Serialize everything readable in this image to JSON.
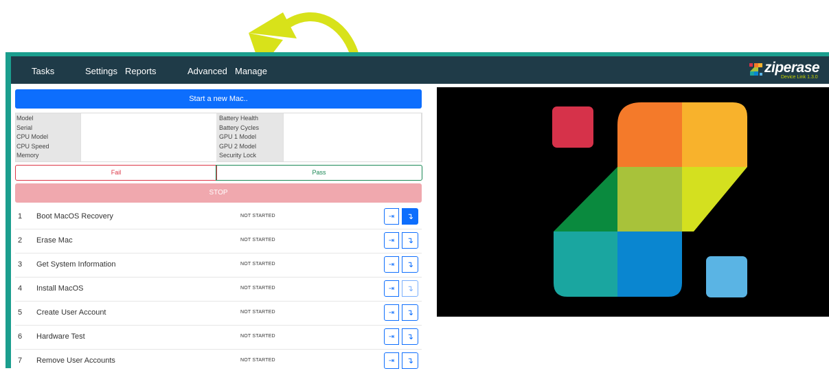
{
  "nav": {
    "tasks": "Tasks",
    "settings": "Settings",
    "reports": "Reports",
    "advanced": "Advanced",
    "manage": "Manage"
  },
  "logo": {
    "name": "ziperase",
    "version": "Device Link 1.3.0"
  },
  "start_button": "Start a new Mac..",
  "info": {
    "left_labels": [
      "Model",
      "Serial",
      "CPU Model",
      "CPU Speed",
      "Memory"
    ],
    "right_labels": [
      "Battery Health",
      "Battery Cycles",
      "GPU 1 Model",
      "GPU 2 Model",
      "Security Lock"
    ]
  },
  "fail_label": "Fail",
  "pass_label": "Pass",
  "stop_label": "STOP",
  "tasks": [
    {
      "num": "1",
      "name": "Boot MacOS Recovery",
      "status": "NOT STARTED"
    },
    {
      "num": "2",
      "name": "Erase Mac",
      "status": "NOT STARTED"
    },
    {
      "num": "3",
      "name": "Get System Information",
      "status": "NOT STARTED"
    },
    {
      "num": "4",
      "name": "Install MacOS",
      "status": "NOT STARTED"
    },
    {
      "num": "5",
      "name": "Create User Account",
      "status": "NOT STARTED"
    },
    {
      "num": "6",
      "name": "Hardware Test",
      "status": "NOT STARTED"
    },
    {
      "num": "7",
      "name": "Remove User Accounts",
      "status": "NOT STARTED"
    }
  ],
  "icons": {
    "run": "run-icon",
    "skip": "skip-icon"
  },
  "colors": {
    "teal_frame": "#1b9e8e",
    "topbar": "#1f3b48",
    "primary": "#0d6efd",
    "stop": "#f0a8ae",
    "arrow": "#d8e21a"
  }
}
